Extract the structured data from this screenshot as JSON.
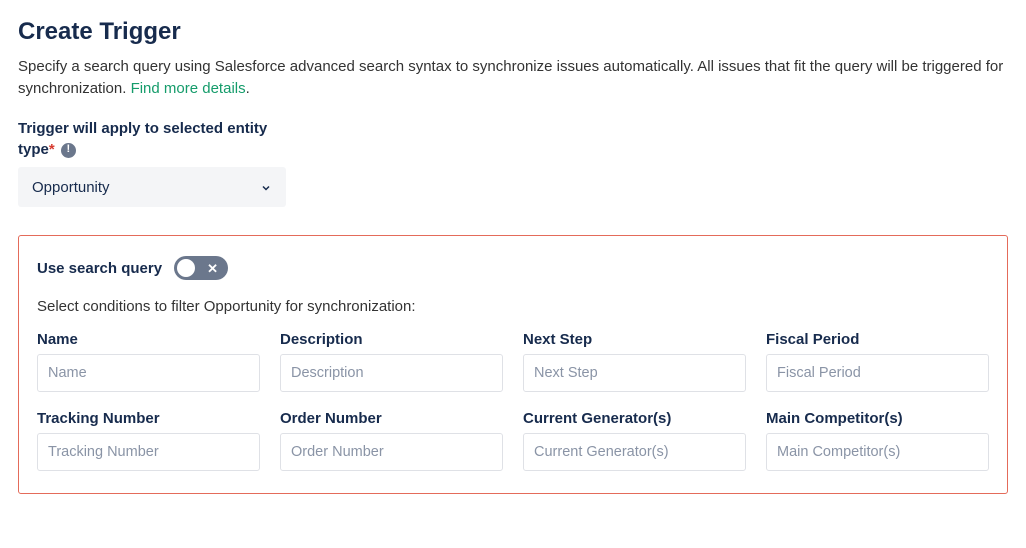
{
  "header": {
    "title": "Create Trigger",
    "description_prefix": "Specify a search query using Salesforce advanced search syntax to synchronize issues automatically. All issues that fit the query will be triggered for synchronization. ",
    "link_text": "Find more details",
    "description_suffix": "."
  },
  "entity_type": {
    "label_line1": "Trigger will apply to selected entity",
    "label_line2": "type",
    "required_marker": "*",
    "selected": "Opportunity"
  },
  "panel": {
    "toggle_label": "Use search query",
    "toggle_state": "off",
    "description": "Select conditions to filter Opportunity for synchronization:",
    "fields": [
      {
        "label": "Name",
        "placeholder": "Name",
        "value": ""
      },
      {
        "label": "Description",
        "placeholder": "Description",
        "value": ""
      },
      {
        "label": "Next Step",
        "placeholder": "Next Step",
        "value": ""
      },
      {
        "label": "Fiscal Period",
        "placeholder": "Fiscal Period",
        "value": ""
      },
      {
        "label": "Tracking Number",
        "placeholder": "Tracking Number",
        "value": ""
      },
      {
        "label": "Order Number",
        "placeholder": "Order Number",
        "value": ""
      },
      {
        "label": "Current Generator(s)",
        "placeholder": "Current Generator(s)",
        "value": ""
      },
      {
        "label": "Main Competitor(s)",
        "placeholder": "Main Competitor(s)",
        "value": ""
      }
    ]
  },
  "colors": {
    "panel_border": "#e46b5a",
    "link": "#159c6b"
  }
}
